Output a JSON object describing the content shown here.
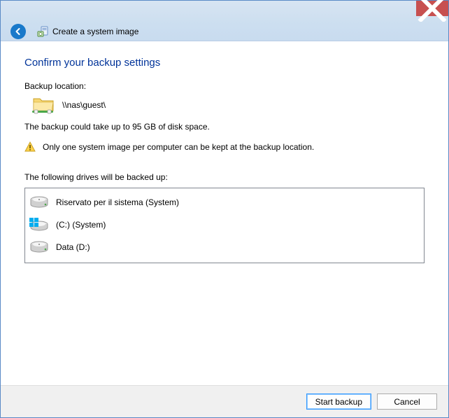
{
  "header": {
    "title": "Create a system image"
  },
  "page": {
    "heading": "Confirm your backup settings",
    "backup_location_label": "Backup location:",
    "backup_location_value": "\\\\nas\\guest\\",
    "size_note": "The backup could take up to 95 GB of disk space.",
    "warning_text": "Only one system image per computer can be kept at the backup location.",
    "drives_label": "The following drives will be backed up:",
    "drives": [
      {
        "name": "Riservato per il sistema (System)",
        "type": "hdd"
      },
      {
        "name": "(C:) (System)",
        "type": "system"
      },
      {
        "name": "Data (D:)",
        "type": "hdd"
      }
    ]
  },
  "buttons": {
    "start": "Start backup",
    "cancel": "Cancel"
  }
}
